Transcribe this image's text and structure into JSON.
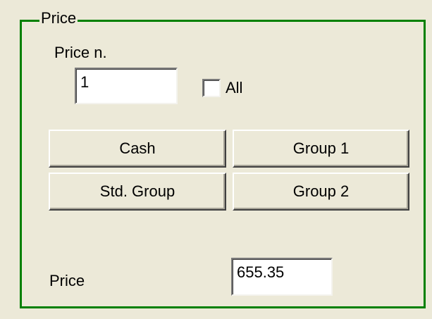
{
  "price_group": {
    "legend": "Price",
    "price_n_label": "Price n.",
    "price_n_value": "1",
    "all_checkbox": {
      "label": "All",
      "checked": false
    },
    "buttons": {
      "cash": "Cash",
      "group1": "Group 1",
      "std_group": "Std. Group",
      "group2": "Group 2"
    },
    "price_label": "Price",
    "price_value": "655.35"
  },
  "colors": {
    "group_border": "#008000",
    "background": "#ece9d8"
  }
}
